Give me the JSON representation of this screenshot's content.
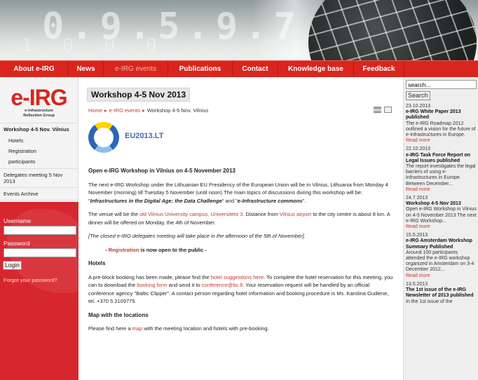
{
  "nav": [
    "About e-IRG",
    "News",
    "e-IRG events",
    "Publications",
    "Contact",
    "Knowledge base",
    "Feedback"
  ],
  "logo": {
    "mark": "e-IRG",
    "sub1": "e-Infrastructure",
    "sub2": "Reflection Group"
  },
  "left_nav": {
    "workshop": "Workshop 4-5 Nov. Vilnius",
    "hotels": "Hotels",
    "registration": "Registration",
    "participants": "participants",
    "delegates": "Delegates meeting 5 Nov 2013",
    "archive": "Events Archive"
  },
  "login": {
    "username": "Username",
    "password": "Password",
    "button": "Login",
    "forgot": "Forgot your password?"
  },
  "page": {
    "title": "Workshop 4-5 Nov 2013",
    "breadcrumb": [
      "Home",
      "e-IRG events",
      "Workshop 4-5 Nov. Vilnius"
    ],
    "eu_logo_text": "EU2013.LT",
    "heading": "Open e-IRG Workshop in Vilnius on 4-5 November 2013",
    "p1a": "The next e-IRG Workshop under the Lithuanian EU Presidency of the European Union will be in Vilnius, Lithuania from Monday 4 November (morning) till Tuesday 5 November (until noon).The main topics of discussions during this workshop will be: \"",
    "p1b": "Infrastructures in the Digital Age: the Data Challenge",
    "p1c": "\" and \"",
    "p1d": "e-Infrastructure commons",
    "p1e": "\".",
    "p2a": "The venue will be the ",
    "p2b": "old Vilnius University campus, Universiteto 3",
    "p2c": ". Distance from ",
    "p2d": "Vilnius airport",
    "p2e": " to the city centre is about 8 km. A dinner will be offered on Monday, the 4th of November.",
    "p3": "[The closed e-IRG delegates meeting will take place in the afternoon of the 5th of November].",
    "reg_a": "- ",
    "reg_b": "Registration",
    "reg_c": " is now open to the public -",
    "hotels_h": "Hotels",
    "h1": "A pre-block booking has been made, please find the ",
    "h2": "hotel suggestions here",
    "h3": ". To complete the hotel reservation for this meeting, you can to download the ",
    "h4": "booking form",
    "h5": " and send it to ",
    "h6": "conference@bc.lt",
    "h7": ". Your reservation request will be handled by an official conference agency \"Baltic Clipper\". A contact person regarding hotel information and booking procedure is Ms. Karolina Gudiene, tel. +370 5 2109775.",
    "map_h": "Map with the locations",
    "m1": "Please find here a ",
    "m2": "map",
    "m3": " with the meeting location and hotels with pre-booking."
  },
  "search": {
    "placeholder": "search...",
    "button": "Search"
  },
  "news": [
    {
      "date": "23.10.2013",
      "title": "e-IRG White Paper 2013 published",
      "text": "The e-IRG Roadmap 2012 outlined a vision for the future of e-Infrastructures in Europe.",
      "more": "Read more"
    },
    {
      "date": "22.10.2013",
      "title": "e-IRG Task Force Report on Legal Issues published",
      "text": "The report investigates the legal barriers of using e-Infrastructures in Europe. Between December...",
      "more": "Read more"
    },
    {
      "date": "24.7.2013",
      "title": "Workshop 4-5 Nov 2013",
      "text": "Open e-IRG Workshop in Vilnius on 4-5 November 2013 The next e-IRG Workshop...",
      "more": "Read more"
    },
    {
      "date": "15.5.2013",
      "title": "e-IRG Amsterdam Workshop Summary Published",
      "text": "Around 100 participants attended the e-IRG workshop organized in Amsterdam on 3-4 December 2012...",
      "more": "Read more"
    },
    {
      "date": "13.5.2013",
      "title": "The 1st issue of the e-IRG Newsletter of 2013 published",
      "text": "In the 1st issue of the",
      "more": ""
    }
  ]
}
